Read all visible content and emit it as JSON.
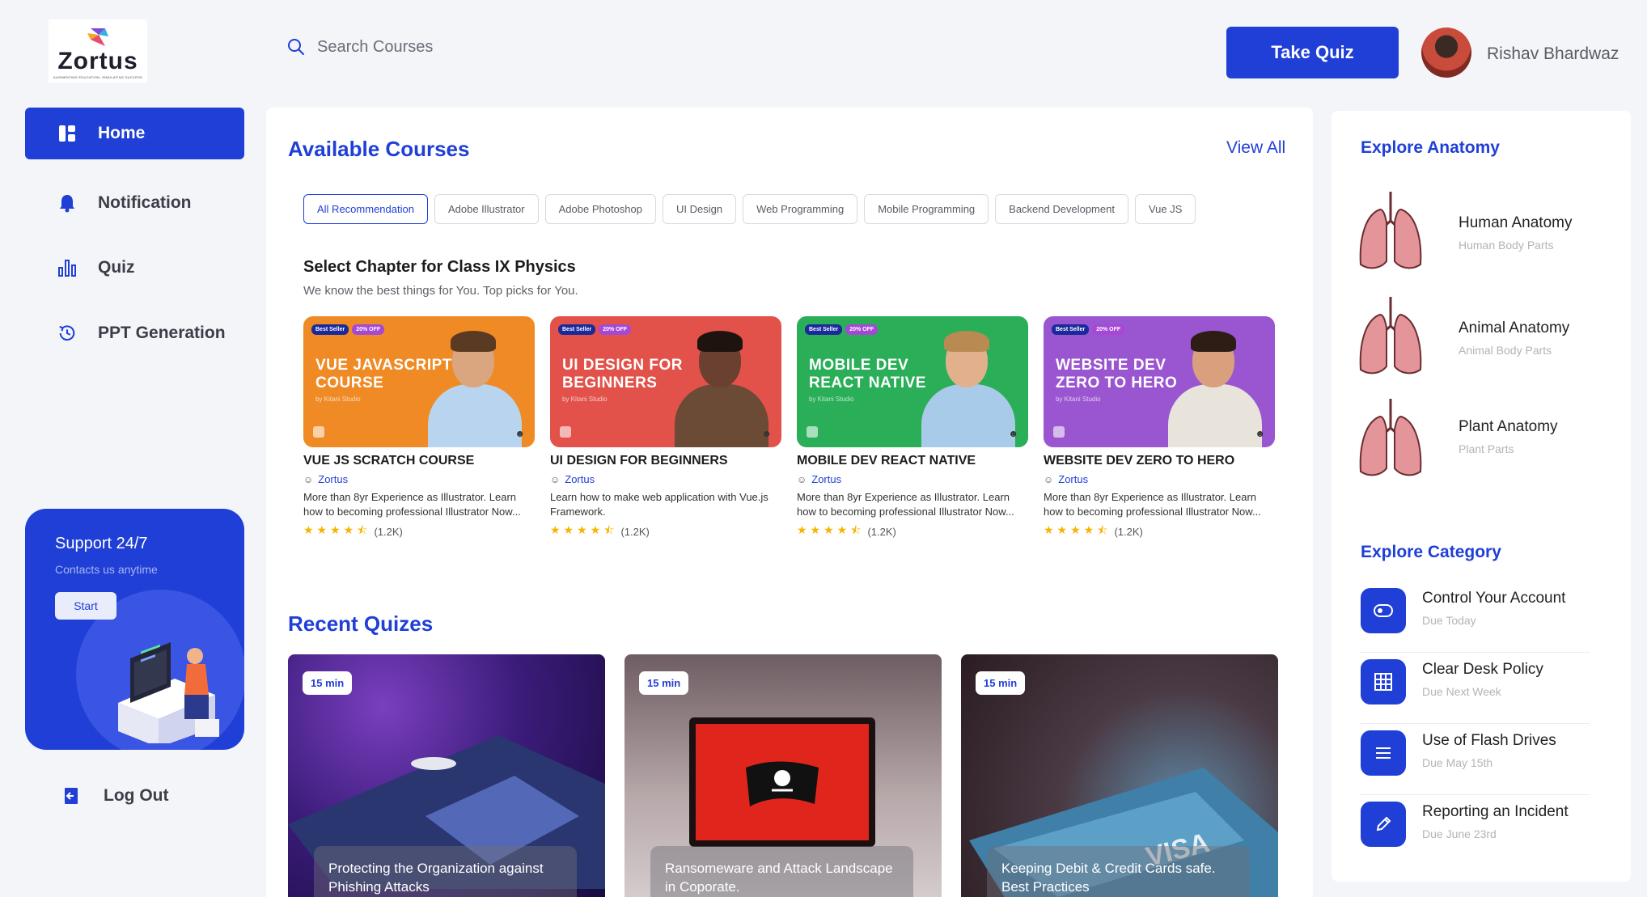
{
  "brand": {
    "name": "Zortus",
    "tagline": "AUGMENTING EDUCATION, SIMULATING SUCCESS"
  },
  "search": {
    "placeholder": "Search Courses"
  },
  "header": {
    "take_quiz": "Take Quiz",
    "user_name": "Rishav Bhardwaz"
  },
  "sidebar": {
    "items": [
      {
        "label": "Home",
        "icon": "dashboard-icon",
        "active": true
      },
      {
        "label": "Notification",
        "icon": "bell-icon"
      },
      {
        "label": "Quiz",
        "icon": "bar-chart-icon"
      },
      {
        "label": "PPT Generation",
        "icon": "history-icon"
      }
    ],
    "support": {
      "title": "Support 24/7",
      "subtitle": "Contacts us anytime",
      "button": "Start"
    },
    "logout": "Log Out"
  },
  "courses_section": {
    "title": "Available Courses",
    "view_all": "View All",
    "chips": [
      "All Recommendation",
      "Adobe Illustrator",
      "Adobe Photoshop",
      "UI Design",
      "Web Programming",
      "Mobile Programming",
      "Backend Development",
      "Vue JS"
    ],
    "chapter_title": "Select Chapter for Class IX Physics",
    "chapter_subtitle": "We know the best things for You.  Top picks for You.",
    "courses": [
      {
        "badge1": "Best Seller",
        "badge2": "20% OFF",
        "thumb_title": "VUE JAVASCRIPT COURSE",
        "thumb_by": "by Kitani Studio",
        "color": "#ef8a25",
        "title": "VUE JS SCRATCH COURSE",
        "author": "Zortus",
        "desc": "More than 8yr Experience as Illustrator. Learn how to becoming professional Illustrator Now...",
        "rating": 4.5,
        "reviews": "(1.2K)"
      },
      {
        "badge1": "Best Seller",
        "badge2": "20% OFF",
        "thumb_title": "UI DESIGN FOR BEGINNERS",
        "thumb_by": "by Kitani Studio",
        "color": "#e2524a",
        "title": "UI DESIGN FOR BEGINNERS",
        "author": "Zortus",
        "desc": "Learn how to make web application with Vue.js Framework.",
        "rating": 4.5,
        "reviews": "(1.2K)"
      },
      {
        "badge1": "Best Seller",
        "badge2": "20% OFF",
        "thumb_title": "MOBILE DEV REACT NATIVE",
        "thumb_by": "by Kitani Studio",
        "color": "#2aae58",
        "title": "MOBILE DEV REACT NATIVE",
        "author": "Zortus",
        "desc": "More than 8yr Experience as Illustrator. Learn how to becoming professional Illustrator Now...",
        "rating": 4.5,
        "reviews": "(1.2K)"
      },
      {
        "badge1": "Best Seller",
        "badge2": "20% OFF",
        "thumb_title": "WEBSITE DEV ZERO TO HERO",
        "thumb_by": "by Kitani Studio",
        "color": "#9a55d0",
        "title": "WEBSITE DEV ZERO TO HERO",
        "author": "Zortus",
        "desc": "More than 8yr Experience as Illustrator. Learn how to becoming professional Illustrator Now...",
        "rating": 4.5,
        "reviews": "(1.2K)"
      }
    ]
  },
  "quizzes_section": {
    "title": "Recent Quizes",
    "quizzes": [
      {
        "duration": "15 min",
        "caption": "Protecting the Organization against Phishing Attacks"
      },
      {
        "duration": "15 min",
        "caption": "Ransomeware and Attack Landscape in Coporate."
      },
      {
        "duration": "15 min",
        "caption": "Keeping Debit & Credit Cards safe. Best Practices"
      }
    ]
  },
  "anatomy": {
    "title": "Explore Anatomy",
    "items": [
      {
        "title": "Human Anatomy",
        "subtitle": "Human Body Parts"
      },
      {
        "title": "Animal Anatomy",
        "subtitle": "Animal Body Parts"
      },
      {
        "title": "Plant Anatomy",
        "subtitle": "Plant Parts"
      }
    ]
  },
  "category": {
    "title": "Explore Category",
    "items": [
      {
        "title": "Control Your Account",
        "subtitle": "Due Today",
        "icon": "toggle-icon"
      },
      {
        "title": "Clear Desk Policy",
        "subtitle": "Due Next Week",
        "icon": "grid-icon"
      },
      {
        "title": "Use of Flash Drives",
        "subtitle": "Due May 15th",
        "icon": "menu-icon"
      },
      {
        "title": "Reporting an Incident",
        "subtitle": "Due June 23rd",
        "icon": "pencil-icon"
      }
    ]
  }
}
